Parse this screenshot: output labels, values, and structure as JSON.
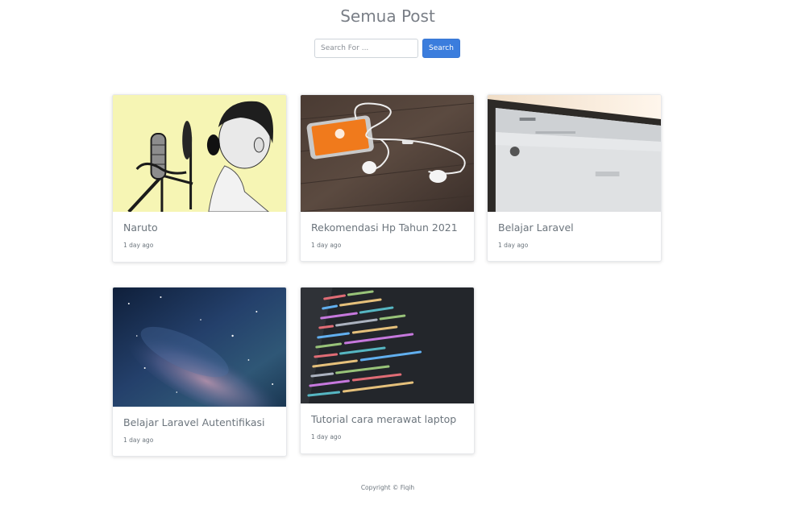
{
  "header": {
    "title": "Semua Post"
  },
  "search": {
    "placeholder": "Search For ...",
    "button_label": "Search"
  },
  "posts": [
    {
      "title": "Naruto",
      "meta": "1 day ago",
      "image": "singer-microphone-image"
    },
    {
      "title": "Rekomendasi Hp Tahun 2021",
      "meta": "1 day ago",
      "image": "phone-earphones-image"
    },
    {
      "title": "Belajar Laravel",
      "meta": "1 day ago",
      "image": "monitor-browser-image"
    },
    {
      "title": "Belajar Laravel Autentifikasi",
      "meta": "1 day ago",
      "image": "night-sky-image"
    },
    {
      "title": "Tutorial cara merawat laptop",
      "meta": "1 day ago",
      "image": "code-screen-image"
    }
  ],
  "footer": {
    "text": "Copyright © Fiqih"
  },
  "colors": {
    "primary": "#3b7ddd",
    "text_muted": "#6c757d"
  }
}
